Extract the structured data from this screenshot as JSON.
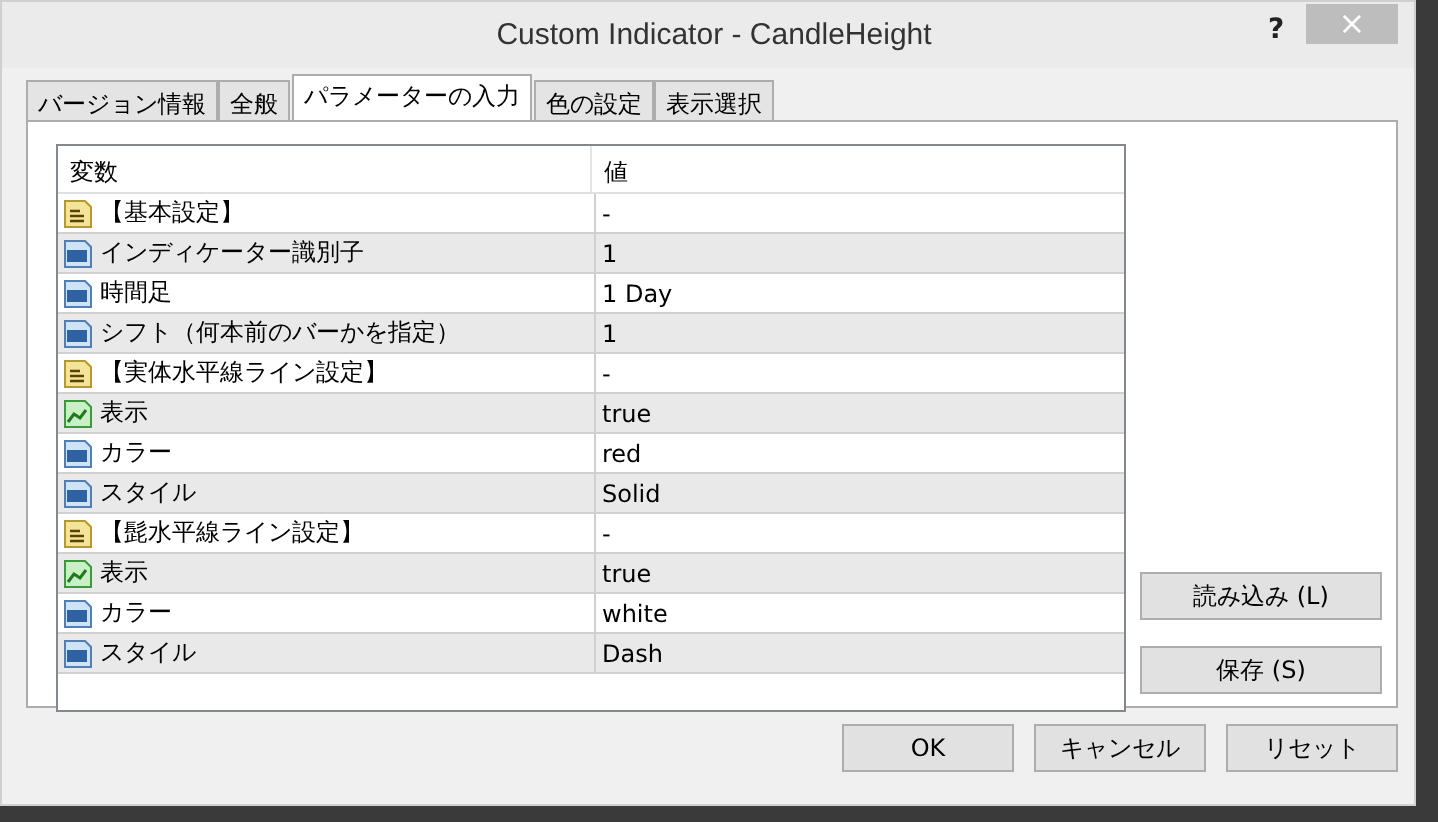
{
  "window": {
    "title": "Custom Indicator - CandleHeight",
    "help": "?",
    "close": "×"
  },
  "tabs": [
    {
      "label": "バージョン情報",
      "selected": false
    },
    {
      "label": "全般",
      "selected": false
    },
    {
      "label": "パラメーターの入力",
      "selected": true
    },
    {
      "label": "色の設定",
      "selected": false
    },
    {
      "label": "表示選択",
      "selected": false
    }
  ],
  "table": {
    "columns": [
      "変数",
      "値"
    ],
    "rows": [
      {
        "kind": "string",
        "name": "【基本設定】",
        "value": "-"
      },
      {
        "kind": "number",
        "name": "インディケーター識別子",
        "value": "1"
      },
      {
        "kind": "number",
        "name": "時間足",
        "value": "1 Day"
      },
      {
        "kind": "number",
        "name": "シフト（何本前のバーかを指定）",
        "value": "1"
      },
      {
        "kind": "string",
        "name": "【実体水平線ライン設定】",
        "value": "-"
      },
      {
        "kind": "bool",
        "name": "表示",
        "value": "true"
      },
      {
        "kind": "number",
        "name": "カラー",
        "value": "red"
      },
      {
        "kind": "number",
        "name": "スタイル",
        "value": "Solid"
      },
      {
        "kind": "string",
        "name": "【髭水平線ライン設定】",
        "value": "-"
      },
      {
        "kind": "bool",
        "name": "表示",
        "value": "true"
      },
      {
        "kind": "number",
        "name": "カラー",
        "value": "white"
      },
      {
        "kind": "number",
        "name": "スタイル",
        "value": "Dash"
      }
    ]
  },
  "side_buttons": [
    "読み込み (L)",
    "保存 (S)"
  ],
  "buttons": [
    "OK",
    "キャンセル",
    "リセット"
  ]
}
